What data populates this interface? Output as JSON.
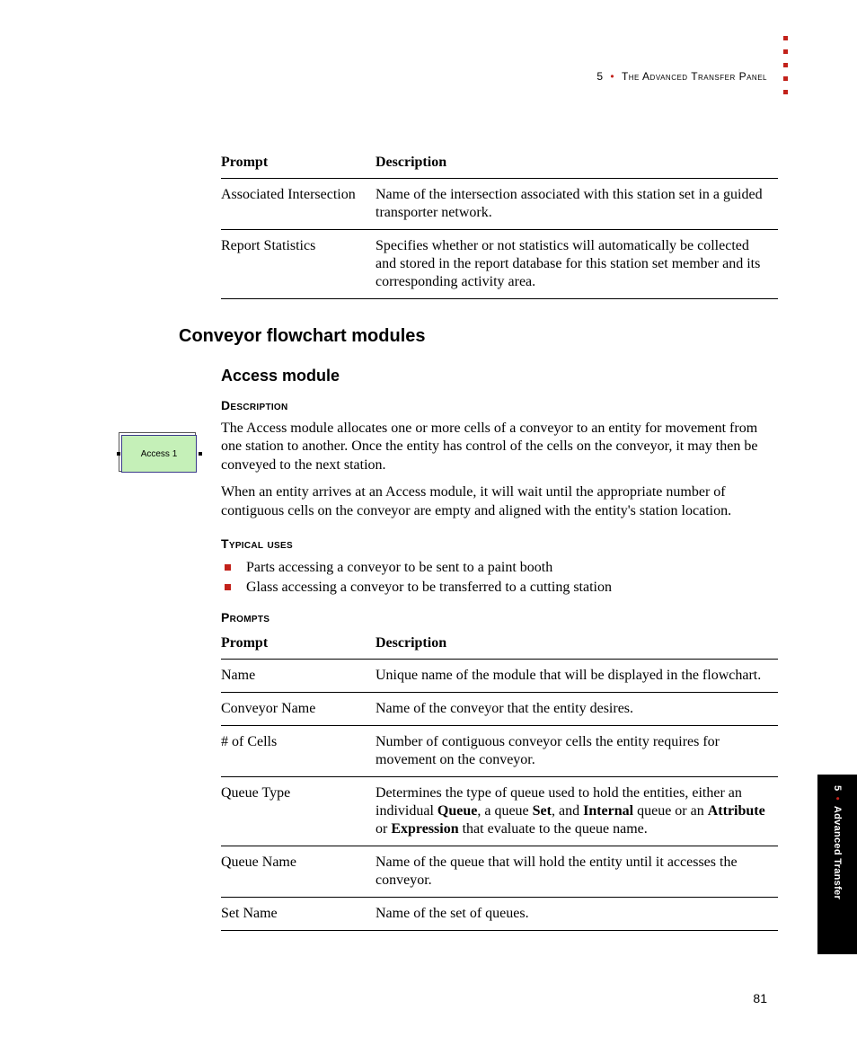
{
  "header": {
    "chapter_number": "5",
    "title": "The Advanced Transfer Panel"
  },
  "table_top": {
    "headers": {
      "prompt": "Prompt",
      "description": "Description"
    },
    "rows": [
      {
        "prompt": "Associated Intersection",
        "description": "Name of the intersection associated with this station set in a guided transporter network."
      },
      {
        "prompt": "Report Statistics",
        "description": "Specifies whether or not statistics will automatically be collected and stored in the report database for this station set member and its corresponding activity area."
      }
    ]
  },
  "section": {
    "title": "Conveyor flowchart modules",
    "subsection": {
      "title": "Access module",
      "description_heading": "Description",
      "description_paragraphs": [
        "The Access module allocates one or more cells of a conveyor to an entity for movement from one station to another. Once the entity has control of the cells on the conveyor, it may then be conveyed to the next station.",
        "When an entity arrives at an Access module, it will wait until the appropriate number of contiguous cells on the conveyor are empty and aligned with the entity's station location."
      ],
      "typical_uses_heading": "Typical uses",
      "typical_uses": [
        "Parts accessing a conveyor to be sent to a paint booth",
        "Glass accessing a conveyor to be transferred to a cutting station"
      ],
      "prompts_heading": "Prompts",
      "prompts_table": {
        "headers": {
          "prompt": "Prompt",
          "description": "Description"
        },
        "rows": [
          {
            "prompt": "Name",
            "description": "Unique name of the module that will be displayed in the flowchart."
          },
          {
            "prompt": "Conveyor Name",
            "description": "Name of the conveyor that the entity desires."
          },
          {
            "prompt": "# of Cells",
            "description": "Number of contiguous conveyor cells the entity requires for movement on the conveyor."
          },
          {
            "prompt": "Queue Type",
            "description_html": "Determines the type of queue used to hold the entities, either an individual <b>Queue</b>, a queue <b>Set</b>, and <b>Internal</b> queue or an <b>Attribute</b> or <b>Expression</b> that evaluate to the queue name."
          },
          {
            "prompt": "Queue Name",
            "description": "Name of the queue that will hold the entity until it accesses the conveyor."
          },
          {
            "prompt": "Set Name",
            "description": "Name of the set of queues."
          }
        ]
      }
    }
  },
  "module_icon_label": "Access 1",
  "side_tab": {
    "chapter_number": "5",
    "label": "Advanced Transfer"
  },
  "page_number": "81"
}
